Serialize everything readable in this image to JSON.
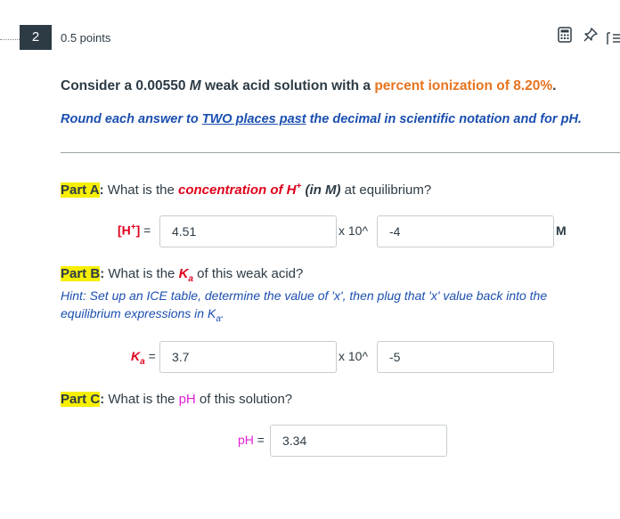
{
  "question": {
    "number": "2",
    "points": "0.5 points"
  },
  "toolbar": {
    "calculator_icon": "calculator-icon",
    "pin_icon": "pin-icon",
    "list_icon": "list-icon"
  },
  "intro": {
    "prefix": "Consider a 0.00550 ",
    "unit": "M",
    "middle": " weak acid solution with a ",
    "highlight": "percent ionization of 8.20%",
    "suffix": "."
  },
  "instruction": {
    "prefix": "Round each answer to ",
    "underline1": "TWO places past",
    "middle": " the decimal in scientific notation and for pH."
  },
  "part_a": {
    "tag": "Part A",
    "colon": ":",
    "text1": " What is the ",
    "highlight": "concentration of H",
    "sup": "+",
    "paren": " (in M)",
    "text2": " at equilibrium?",
    "input_label": "[H",
    "input_label_sup": "+",
    "input_label_close": "]",
    "equals": " =",
    "mantissa": "4.51",
    "times": "x 10^",
    "exponent": "-4",
    "unit": "M"
  },
  "part_b": {
    "tag": "Part B",
    "colon": ":",
    "text1": " What is the ",
    "ka_k": "K",
    "ka_sub": "a",
    "text2": " of this weak acid?",
    "hint": "Hint: Set up an ICE table, determine the value of 'x', then plug that 'x' value back into the equilibrium expressions in K",
    "hint_sub": "a",
    "hint_end": ".",
    "input_label": "K",
    "input_label_sub": "a",
    "equals": " =",
    "mantissa": "3.7",
    "times": "x 10^",
    "exponent": "-5"
  },
  "part_c": {
    "tag": "Part C",
    "colon": ":",
    "text1": " What is the ",
    "highlight": "pH",
    "text2": " of this solution?",
    "input_label": "pH",
    "equals": " =",
    "value": "3.34"
  },
  "colors": {
    "orange": "#e8731e",
    "blue": "#1b4fb0",
    "red": "#e0001b",
    "magenta": "#e020d8",
    "yellow": "#f6ef00"
  }
}
